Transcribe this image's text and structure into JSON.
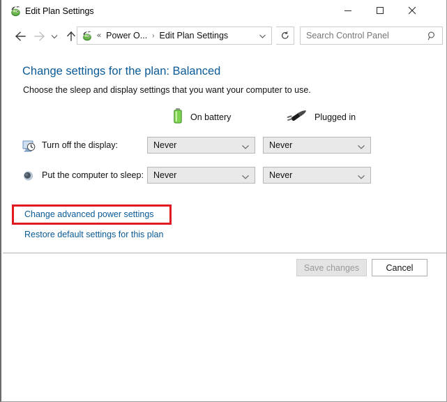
{
  "window": {
    "title": "Edit Plan Settings",
    "app_icon": "power-plan-icon",
    "accent_color": "#117a8b",
    "controls": {
      "minimize": "minimize-icon",
      "maximize": "maximize-icon",
      "close": "close-icon"
    }
  },
  "navbar": {
    "back": "back-arrow-icon",
    "forward": "forward-arrow-icon",
    "recent": "recent-pages-chevron-icon",
    "up": "up-arrow-icon",
    "address": {
      "icon": "power-plan-icon",
      "overflow": "«",
      "segments": [
        "Power O...",
        "Edit Plan Settings"
      ],
      "separator": "›",
      "dropdown": "chevron-down-icon"
    },
    "refresh": "refresh-icon",
    "search": {
      "placeholder": "Search Control Panel",
      "value": "",
      "icon": "search-icon"
    }
  },
  "main": {
    "title": "Change settings for the plan: Balanced",
    "subtitle": "Choose the sleep and display settings that you want your computer to use.",
    "columns": [
      {
        "label": "On battery",
        "icon": "battery-icon"
      },
      {
        "label": "Plugged in",
        "icon": "power-plug-icon"
      }
    ],
    "settings": [
      {
        "icon": "display-clock-icon",
        "label": "Turn off the display:",
        "on_battery": "Never",
        "plugged_in": "Never"
      },
      {
        "icon": "sleep-moon-icon",
        "label": "Put the computer to sleep:",
        "on_battery": "Never",
        "plugged_in": "Never"
      }
    ],
    "links": [
      {
        "label": "Change advanced power settings",
        "highlighted": true
      },
      {
        "label": "Restore default settings for this plan",
        "highlighted": false
      }
    ],
    "highlight_color": "#e01a20",
    "link_color": "#0a5a96"
  },
  "footer": {
    "save_label": "Save changes",
    "save_enabled": false,
    "cancel_label": "Cancel"
  }
}
